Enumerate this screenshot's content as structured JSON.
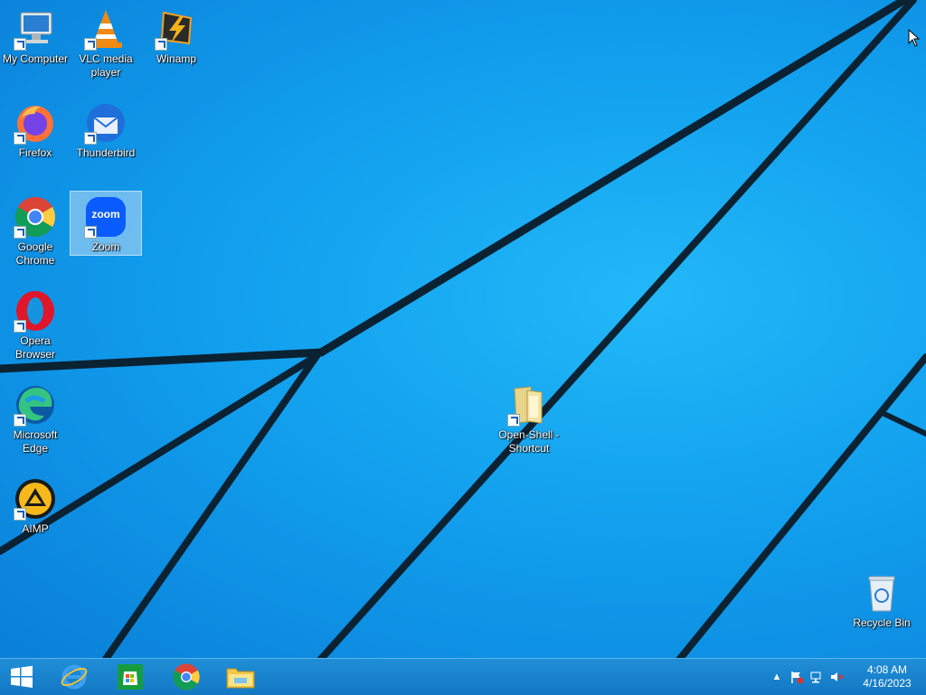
{
  "desktop": {
    "icons": [
      {
        "label": "My Computer",
        "icon": "computer-icon"
      },
      {
        "label": "VLC media player",
        "icon": "vlc-icon"
      },
      {
        "label": "Winamp",
        "icon": "winamp-icon"
      },
      {
        "label": "Firefox",
        "icon": "firefox-icon"
      },
      {
        "label": "Thunderbird",
        "icon": "thunderbird-icon"
      },
      {
        "label": "Google Chrome",
        "icon": "chrome-icon"
      },
      {
        "label": "Zoom",
        "icon": "zoom-icon",
        "selected": true,
        "logo_text": "zoom"
      },
      {
        "label": "Opera Browser",
        "icon": "opera-icon"
      },
      {
        "label": "Microsoft Edge",
        "icon": "edge-icon"
      },
      {
        "label": "AIMP",
        "icon": "aimp-icon"
      },
      {
        "label": "Open-Shell - Shortcut",
        "icon": "folder-icon"
      },
      {
        "label": "Recycle Bin",
        "icon": "recycle-bin-icon"
      }
    ]
  },
  "taskbar": {
    "pinned": [
      {
        "name": "start-button",
        "icon": "windows-logo-icon"
      },
      {
        "name": "internet-explorer",
        "icon": "ie-icon"
      },
      {
        "name": "store",
        "icon": "store-icon"
      },
      {
        "name": "chrome",
        "icon": "chrome-icon"
      },
      {
        "name": "file-explorer",
        "icon": "file-explorer-icon"
      }
    ],
    "tray": {
      "icons": [
        "show-hidden-icons-chevron",
        "action-center-flag-icon",
        "network-icon",
        "volume-muted-icon"
      ],
      "time": "4:08 AM",
      "date": "4/16/2023"
    }
  },
  "colors": {
    "desktop_blue": "#12a0ee",
    "taskbar": "#1478c4",
    "wallpaper_lines": "#0b2233"
  }
}
